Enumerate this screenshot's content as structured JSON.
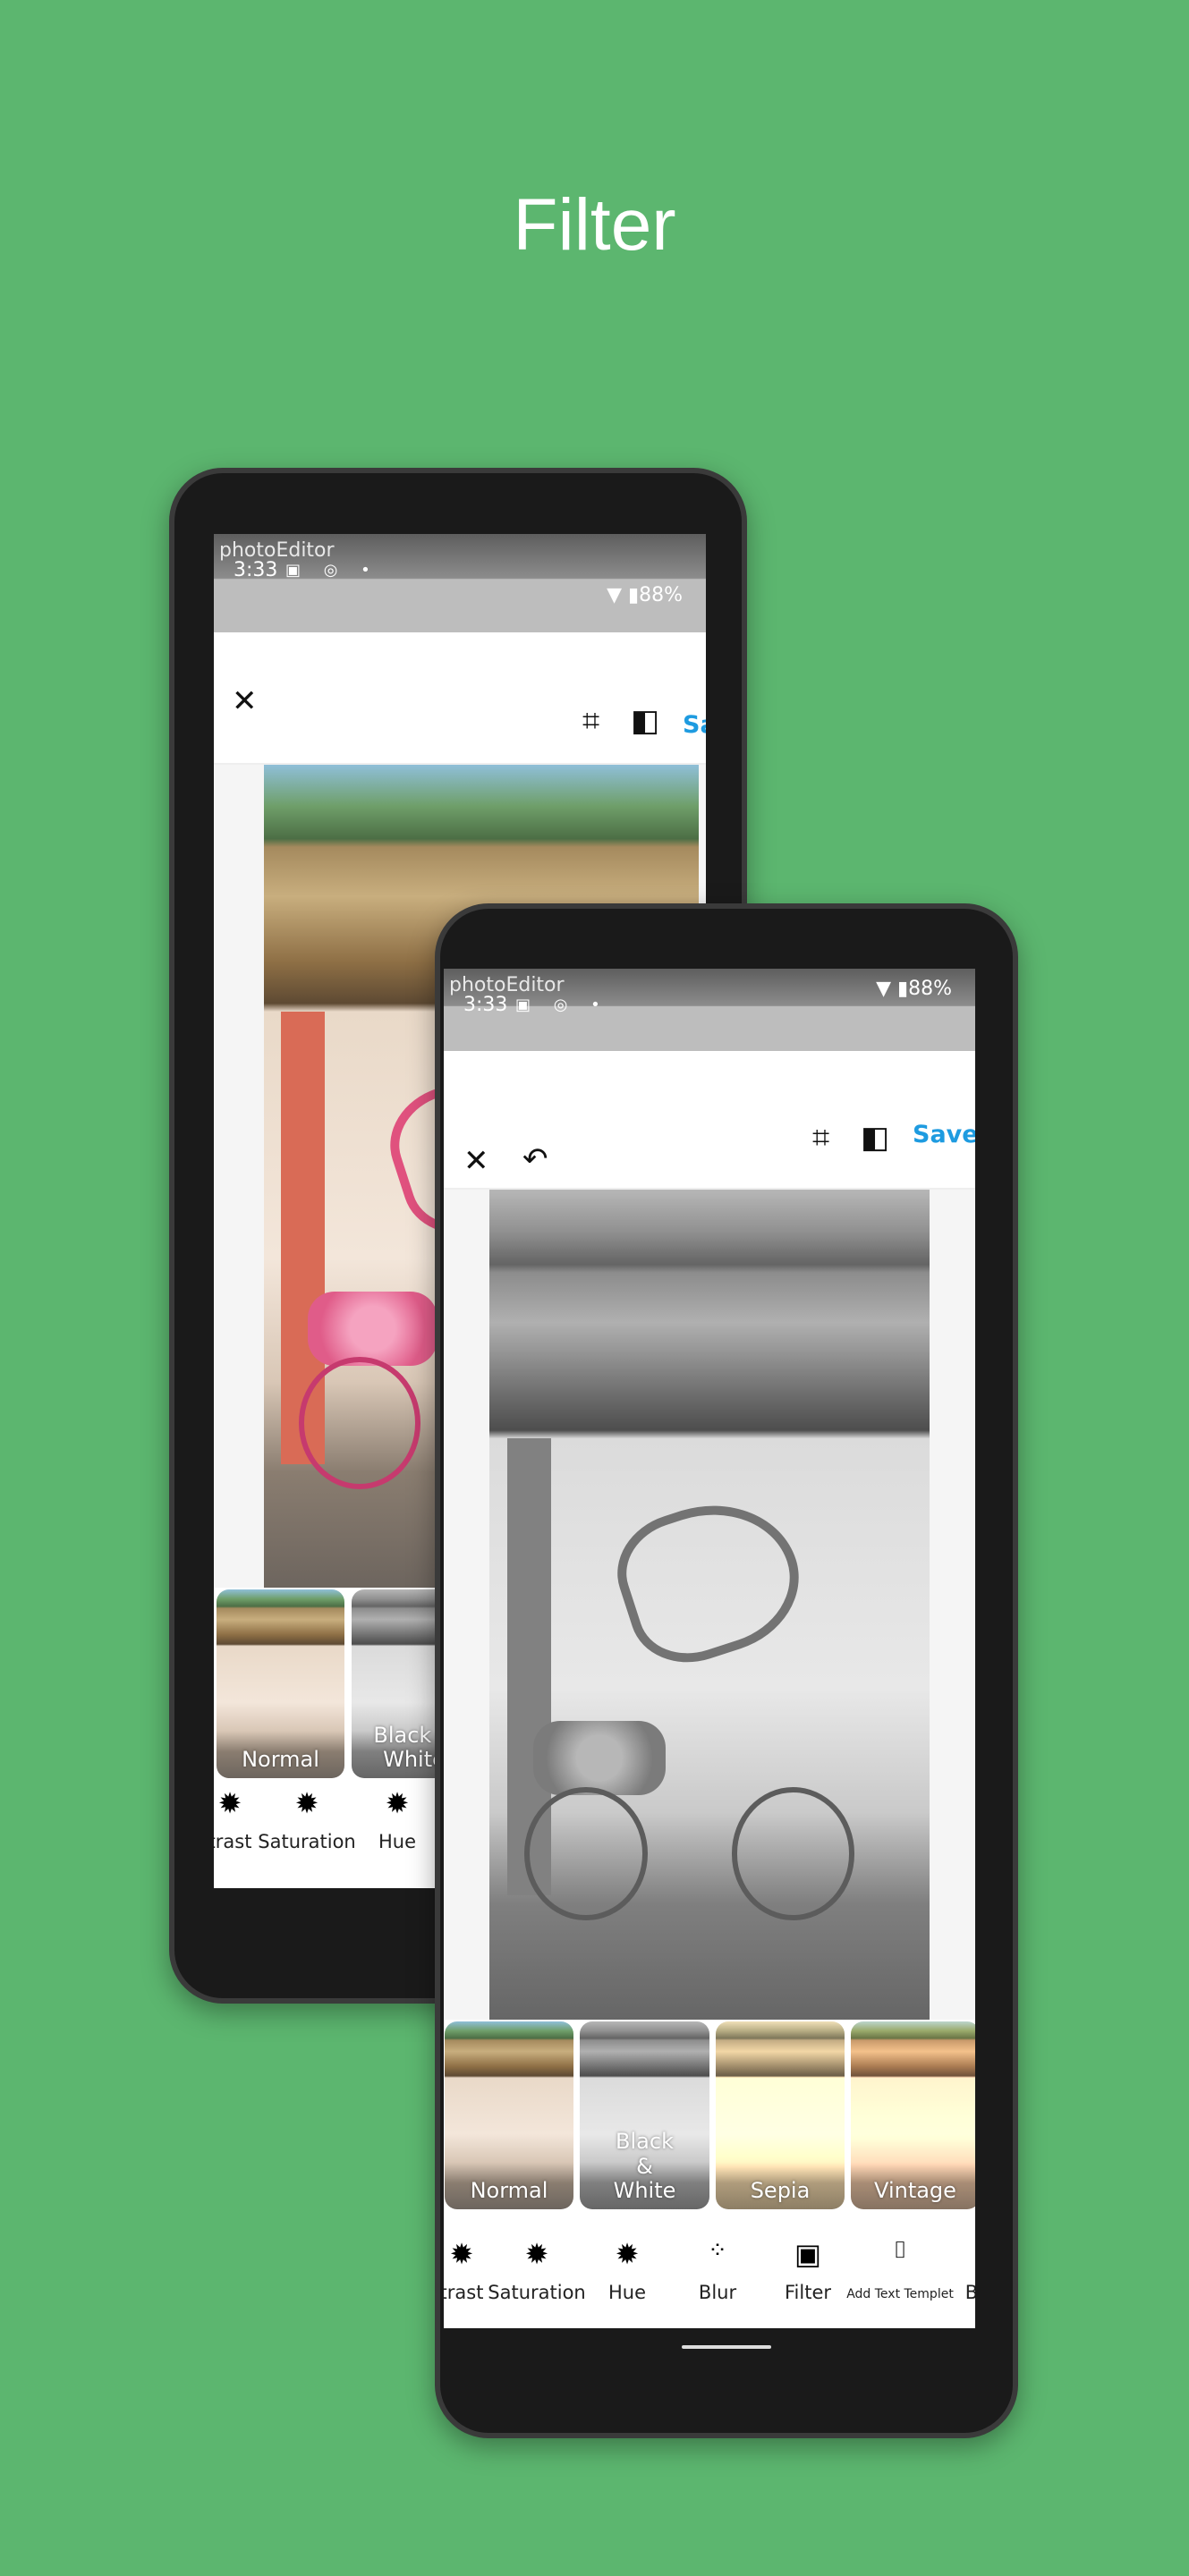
{
  "heading": "Filter",
  "status_bar": {
    "app_label": "photoEditor",
    "time": "3:33",
    "battery": "88%"
  },
  "appbar": {
    "close_icon": "close-icon",
    "undo_icon": "undo-icon",
    "crop_icon": "crop-icon",
    "compare_icon": "compare-icon",
    "save_label": "Save"
  },
  "filters": [
    {
      "label": "Normal"
    },
    {
      "label": "Black & White"
    },
    {
      "label": "Sepia"
    },
    {
      "label": "Vintage"
    }
  ],
  "back_filters": [
    {
      "label": "Normal"
    },
    {
      "label": "Black & White"
    }
  ],
  "tools": [
    {
      "label": "trast",
      "icon": "contrast-icon"
    },
    {
      "label": "Saturation",
      "icon": "saturation-icon"
    },
    {
      "label": "Hue",
      "icon": "hue-icon"
    },
    {
      "label": "Blur",
      "icon": "blur-icon"
    },
    {
      "label": "Filter",
      "icon": "image-icon"
    },
    {
      "label": "Add Text Templet",
      "icon": "text-template-icon"
    },
    {
      "label": "B",
      "icon": ""
    }
  ],
  "colors": {
    "background": "#5cb66f",
    "accent": "#1e9be0"
  }
}
